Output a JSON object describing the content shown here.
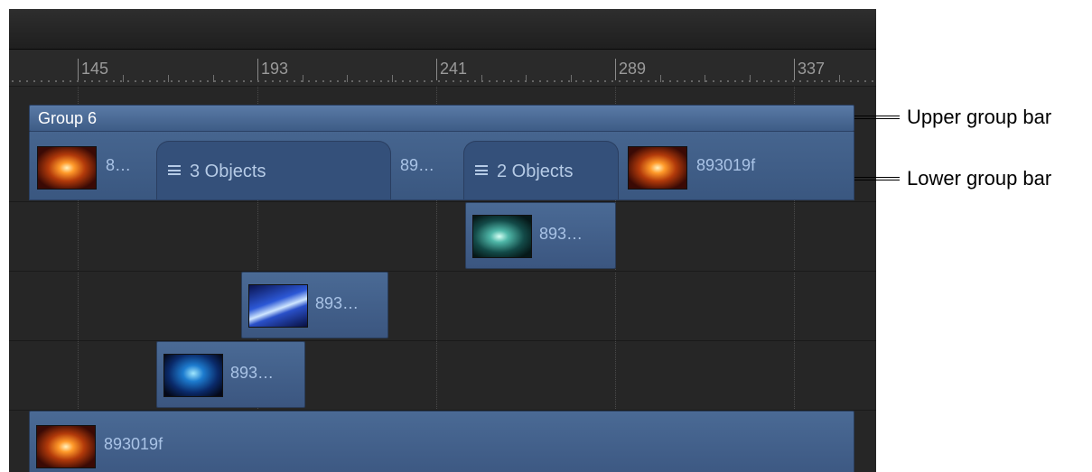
{
  "ruler": {
    "ticks": [
      "145",
      "193",
      "241",
      "289",
      "337"
    ]
  },
  "group": {
    "title": "Group 6"
  },
  "lower_bar": {
    "clip_a_label": "8…",
    "folder_1_label": "3 Objects",
    "clip_b_label": "89…",
    "folder_2_label": "2 Objects",
    "clip_c_label": "893019f"
  },
  "tracks": {
    "row1_label": "893…",
    "row2_label": "893…",
    "row3_label": "893…",
    "row4_label": "893019f"
  },
  "callouts": {
    "upper": "Upper group bar",
    "lower": "Lower group bar"
  },
  "colors": {
    "clip_blue": "#3e5c86",
    "timeline_bg": "#262626"
  }
}
